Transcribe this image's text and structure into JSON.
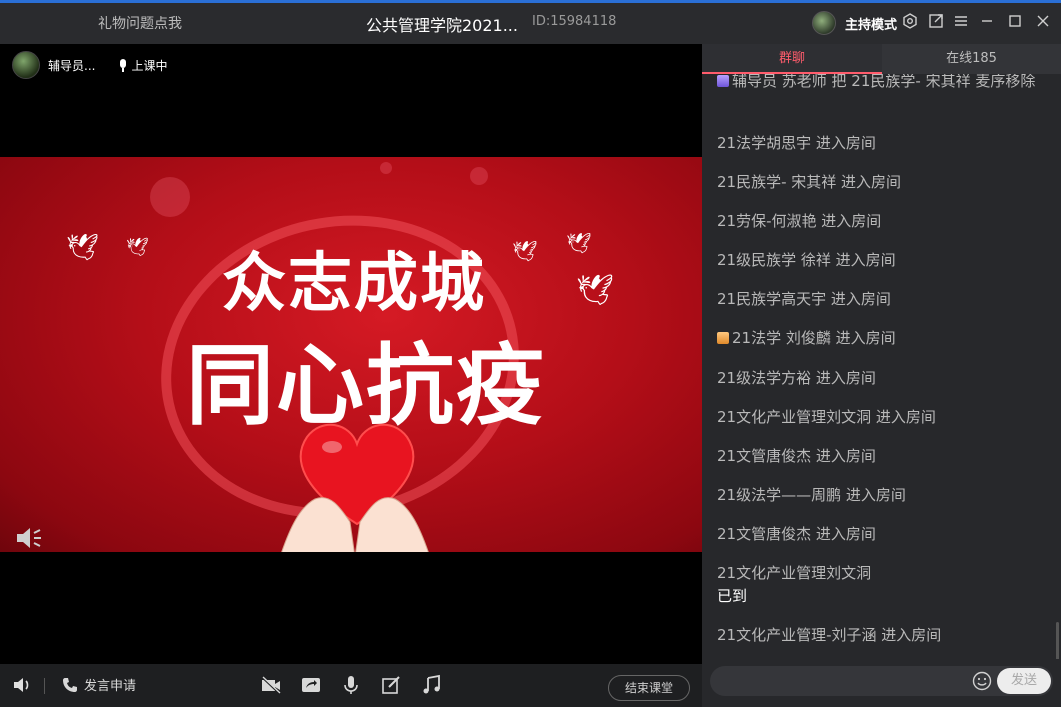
{
  "titlebar": {
    "gift_text": "礼物问题点我",
    "title": "公共管理学院2021...",
    "room_id": "ID:15984118",
    "host_mode": "主持模式"
  },
  "presenter": {
    "name": "辅导员...",
    "status": "上课中"
  },
  "slide": {
    "line1": "众志成城",
    "line2": "同心抗疫",
    "bg_color": "#c3111b"
  },
  "bottombar": {
    "apply_label": "发言申请",
    "end_label": "结束课堂"
  },
  "chat": {
    "tabs": [
      {
        "label": "群聊",
        "active": true
      },
      {
        "label": "在线185",
        "active": false
      }
    ],
    "messages": [
      {
        "text": "辅导员 苏老师 把 21民族学- 宋其祥 麦序移除",
        "badge": "purple"
      },
      {
        "text": "21法学胡思宇 进入房间"
      },
      {
        "text": "21民族学- 宋其祥 进入房间"
      },
      {
        "text": "21劳保-何淑艳 进入房间"
      },
      {
        "text": "21级民族学  徐祥 进入房间"
      },
      {
        "text": "21民族学高天宇 进入房间"
      },
      {
        "text": "21法学 刘俊麟 进入房间",
        "badge": "orange"
      },
      {
        "text": "21级法学方裕 进入房间"
      },
      {
        "text": "21文化产业管理刘文洞 进入房间"
      },
      {
        "text": "21文管唐俊杰 进入房间"
      },
      {
        "text": "21级法学——周鹏 进入房间"
      },
      {
        "text": "21文管唐俊杰 进入房间"
      },
      {
        "text": "21文化产业管理刘文洞",
        "text2": "已到"
      },
      {
        "text": "21文化产业管理-刘子涵 进入房间"
      }
    ],
    "send_label": "发送",
    "accent_color": "#ff5c6c"
  }
}
